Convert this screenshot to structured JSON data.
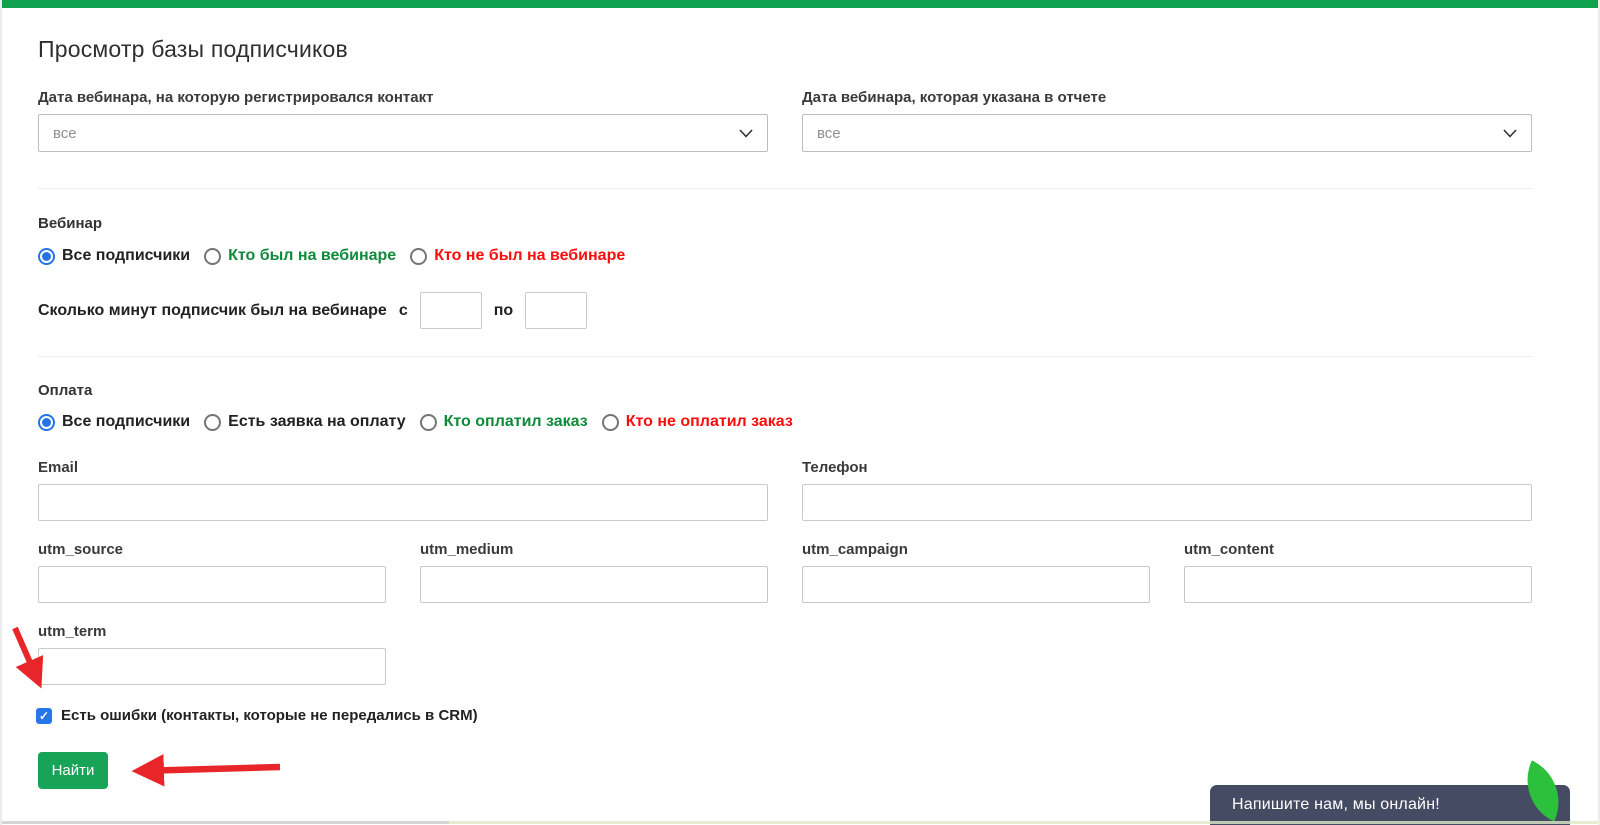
{
  "page": {
    "title": "Просмотр базы подписчиков"
  },
  "filters": {
    "webinar_date_registered": {
      "label": "Дата вебинара, на которую регистрировался контакт",
      "value": "все"
    },
    "webinar_date_report": {
      "label": "Дата вебинара, которая указана в отчете",
      "value": "все"
    }
  },
  "webinar_section": {
    "title": "Вебинар",
    "options": [
      {
        "label": "Все подписчики",
        "selected": true
      },
      {
        "label": "Кто был на вебинаре",
        "selected": false
      },
      {
        "label": "Кто не был на вебинаре",
        "selected": false
      }
    ],
    "minutes": {
      "label": "Сколько минут подписчик был на вебинаре",
      "from_label": "с",
      "to_label": "по",
      "from_value": "",
      "to_value": ""
    }
  },
  "payment_section": {
    "title": "Оплата",
    "options": [
      {
        "label": "Все подписчики",
        "selected": true
      },
      {
        "label": "Есть заявка на оплату",
        "selected": false
      },
      {
        "label": "Кто оплатил заказ",
        "selected": false
      },
      {
        "label": "Кто не оплатил заказ",
        "selected": false
      }
    ]
  },
  "fields": {
    "email": {
      "label": "Email",
      "value": ""
    },
    "phone": {
      "label": "Телефон",
      "value": ""
    },
    "utm_source": {
      "label": "utm_source",
      "value": ""
    },
    "utm_medium": {
      "label": "utm_medium",
      "value": ""
    },
    "utm_campaign": {
      "label": "utm_campaign",
      "value": ""
    },
    "utm_content": {
      "label": "utm_content",
      "value": ""
    },
    "utm_term": {
      "label": "utm_term",
      "value": ""
    }
  },
  "errors_checkbox": {
    "label": "Есть ошибки (контакты, которые не передались в CRM)",
    "checked": true
  },
  "search_button": {
    "label": "Найти"
  },
  "chat_widget": {
    "label": "Напишите нам, мы онлайн!"
  },
  "icons": {
    "select_chevron": "chevron-down",
    "checkbox_check": "✓"
  },
  "colors": {
    "accent_green": "#0fa14d",
    "button_green": "#17a458",
    "option_green": "#108a3b",
    "option_red": "#fc0d0d",
    "radio_blue": "#2673e8",
    "checkbox_blue": "#2776ea",
    "arrow_red": "#e8262a",
    "chat_panel": "#454b63",
    "chat_leaf_green": "#2cc13c"
  }
}
